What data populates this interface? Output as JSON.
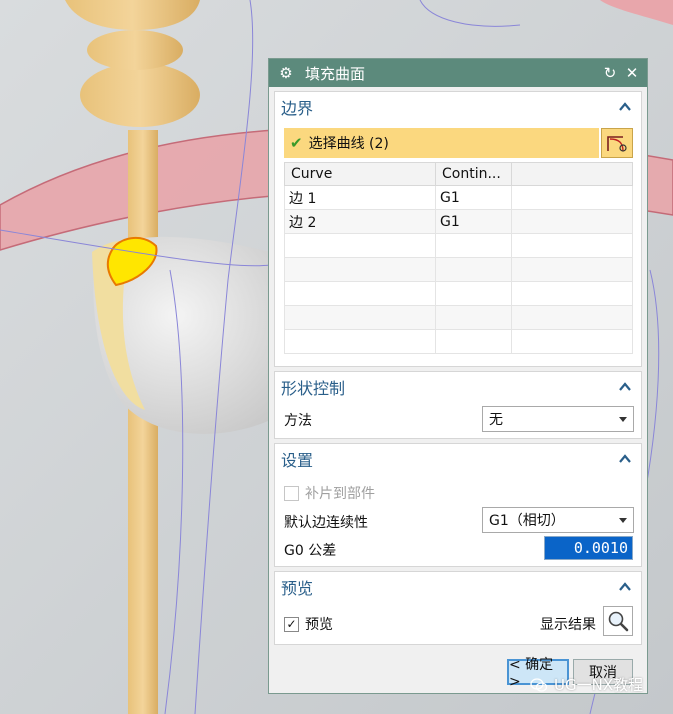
{
  "dialog": {
    "title": "填充曲面",
    "boundary": {
      "header": "边界",
      "select_label": "选择曲线 (2)",
      "columns": [
        "Curve",
        "Contin..."
      ],
      "rows": [
        {
          "curve": "边 1",
          "continuity": "G1"
        },
        {
          "curve": "边 2",
          "continuity": "G1"
        }
      ]
    },
    "shape_control": {
      "header": "形状控制",
      "method_label": "方法",
      "method_value": "无"
    },
    "settings": {
      "header": "设置",
      "patch_to_part_label": "补片到部件",
      "default_continuity_label": "默认边连续性",
      "default_continuity_value": "G1（相切）",
      "g0_tolerance_label": "G0 公差",
      "g0_tolerance_value": "0.0010"
    },
    "preview": {
      "header": "预览",
      "preview_label": "预览",
      "show_result_label": "显示结果"
    },
    "ok_label": "< 确定 >",
    "cancel_label": "取消"
  },
  "watermark": "UG一NX教程",
  "colors": {
    "title_bar": "#5c8a7c",
    "section_header_text": "#2a5f8a",
    "selection_highlight": "#fbd87f",
    "tolerance_field": "#0a64c8"
  }
}
